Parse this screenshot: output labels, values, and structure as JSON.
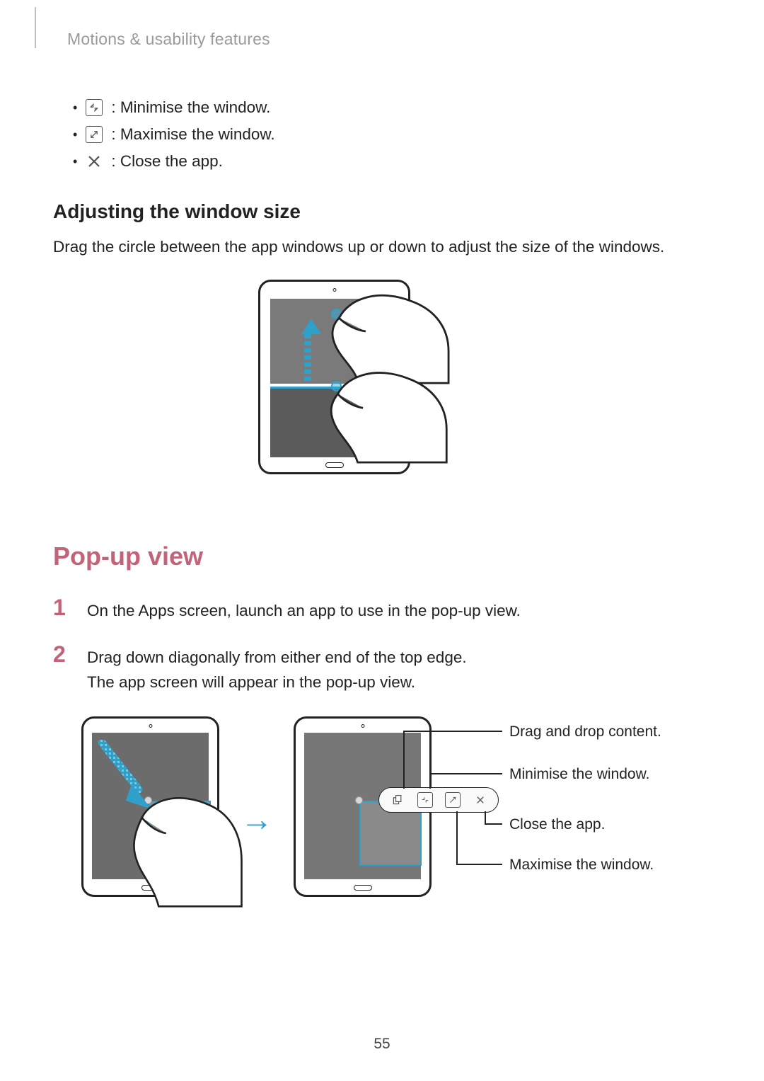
{
  "header": {
    "breadcrumb": "Motions & usability features"
  },
  "icon_bullets": [
    {
      "icon_name": "minimise-icon",
      "glyph": "↘↖",
      "text": ": Minimise the window."
    },
    {
      "icon_name": "maximise-icon",
      "glyph": "↗",
      "text": ": Maximise the window."
    },
    {
      "icon_name": "close-icon",
      "glyph": "✕",
      "text": ": Close the app."
    }
  ],
  "subheading": "Adjusting the window size",
  "adjust_text": "Drag the circle between the app windows up or down to adjust the size of the windows.",
  "popup": {
    "title": "Pop-up view",
    "steps": [
      {
        "num": "1",
        "lines": [
          "On the Apps screen, launch an app to use in the pop-up view."
        ]
      },
      {
        "num": "2",
        "lines": [
          "Drag down diagonally from either end of the top edge.",
          "The app screen will appear in the pop-up view."
        ]
      }
    ],
    "callouts": {
      "drag": "Drag and drop content.",
      "min": "Minimise the window.",
      "close": "Close the app.",
      "max": "Maximise the window."
    },
    "toolbar_icons": [
      "drag-content-icon",
      "minimise-icon",
      "maximise-icon",
      "close-icon"
    ]
  },
  "page_number": "55"
}
